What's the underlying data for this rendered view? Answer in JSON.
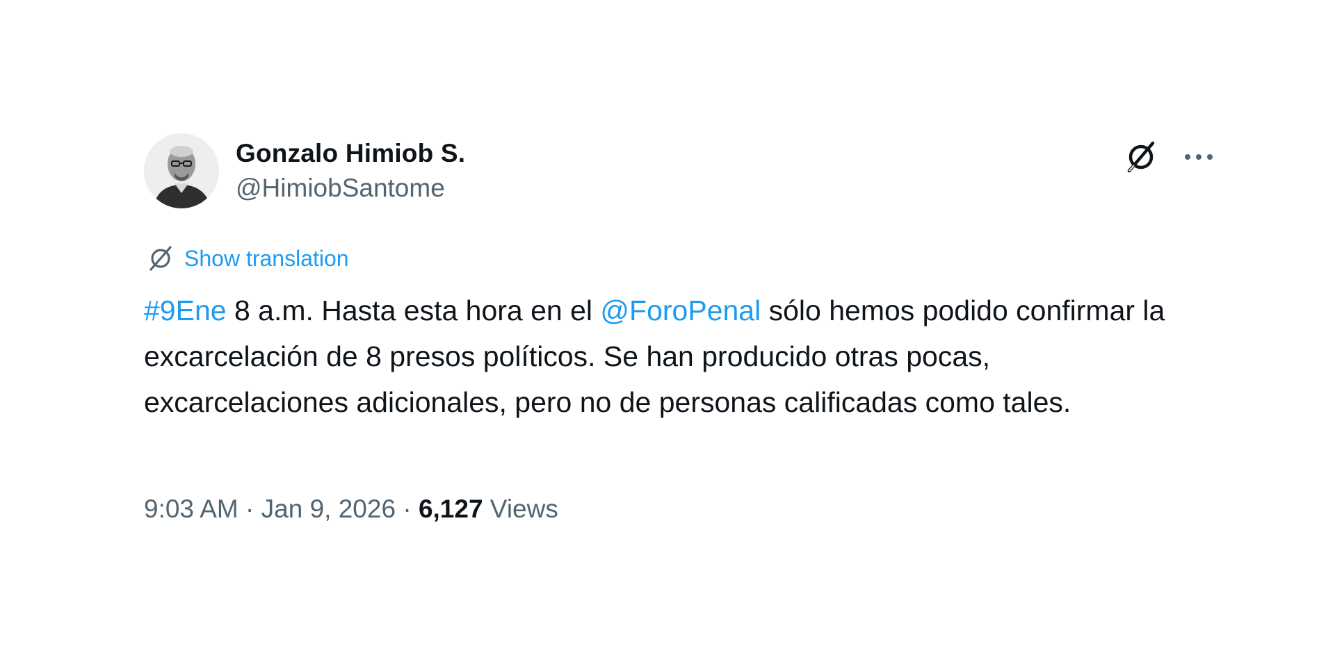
{
  "author": {
    "display_name": "Gonzalo Himiob S.",
    "handle": "@HimiobSantome"
  },
  "actions": {
    "grok_icon": "grok-icon",
    "more_icon": "more-icon"
  },
  "translation": {
    "label": "Show translation",
    "icon": "translate-icon"
  },
  "tweet": {
    "hashtag": "#9Ene",
    "text_1": " 8 a.m. Hasta esta hora en el ",
    "mention": "@ForoPenal",
    "text_2": " sólo hemos podido confirmar la excarcelación de 8 presos políticos. Se han producido otras pocas, excarcelaciones adicionales, pero no de personas calificadas como tales."
  },
  "meta": {
    "time": "9:03 AM",
    "separator_1": " · ",
    "date": "Jan 9, 2026",
    "separator_2": " · ",
    "views_count": "6,127",
    "views_label": " Views"
  },
  "colors": {
    "link": "#1d9bf0",
    "text_primary": "#0f1419",
    "text_secondary": "#536471"
  }
}
